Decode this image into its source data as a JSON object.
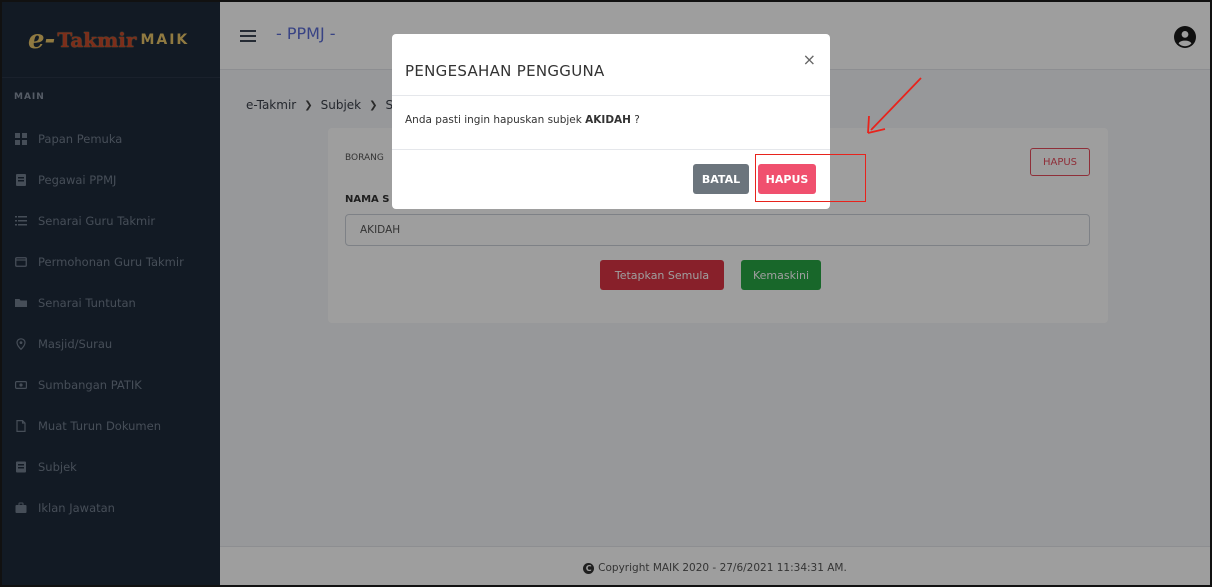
{
  "brand": {
    "e": "e-",
    "takmir": "Takmir",
    "maik": "MAIK"
  },
  "sidebar": {
    "heading": "MAIN",
    "items": [
      {
        "label": "Papan Pemuka",
        "icon": "dashboard-icon"
      },
      {
        "label": "Pegawai PPMJ",
        "icon": "id-card-icon"
      },
      {
        "label": "Senarai Guru Takmir",
        "icon": "list-icon"
      },
      {
        "label": "Permohonan Guru Takmir",
        "icon": "window-icon"
      },
      {
        "label": "Senarai Tuntutan",
        "icon": "folder-icon"
      },
      {
        "label": "Masjid/Surau",
        "icon": "map-pin-icon"
      },
      {
        "label": "Sumbangan PATIK",
        "icon": "money-icon"
      },
      {
        "label": "Muat Turun Dokumen",
        "icon": "file-icon"
      },
      {
        "label": "Subjek",
        "icon": "book-icon"
      },
      {
        "label": "Iklan Jawatan",
        "icon": "briefcase-icon"
      }
    ]
  },
  "topbar": {
    "title": "- PPMJ -"
  },
  "breadcrumb": {
    "items": [
      "e-Takmir",
      "Subjek",
      "S"
    ]
  },
  "card": {
    "title": "BORANG",
    "delete_label": "HAPUS",
    "field_label": "NAMA S",
    "field_value": "AKIDAH",
    "reset_label": "Tetapkan Semula",
    "update_label": "Kemaskini"
  },
  "footer": {
    "text": "Copyright MAIK 2020 - 27/6/2021 11:34:31 AM."
  },
  "modal": {
    "title": "PENGESAHAN PENGGUNA",
    "close": "×",
    "message_prefix": "Anda pasti ingin hapuskan subjek ",
    "message_subject": "AKIDAH",
    "message_suffix": " ?",
    "cancel_label": "BATAL",
    "confirm_label": "HAPUS"
  },
  "colors": {
    "sidebar_bg": "#1e2a3a",
    "accent": "#5b6dd6",
    "danger": "#dc3545",
    "success": "#28a745",
    "confirm": "#f0506e",
    "annotation": "#e8231c"
  }
}
